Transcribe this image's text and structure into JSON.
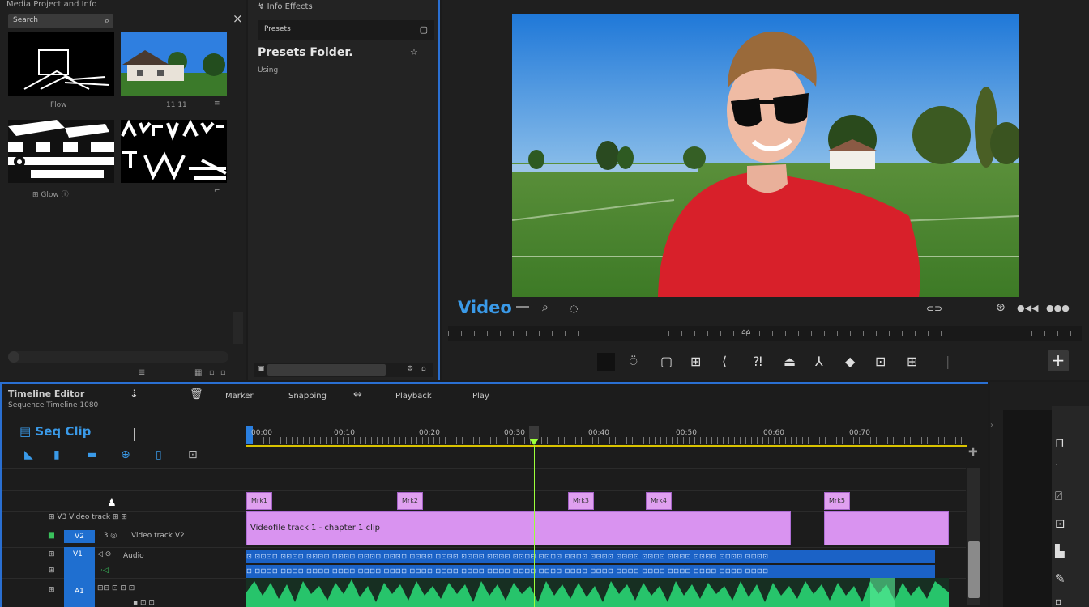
{
  "media": {
    "header": "Media Project and Info",
    "search_label": "Search",
    "items": [
      {
        "label": "Flow"
      },
      {
        "label": "11 11"
      },
      {
        "label": "Glow"
      },
      {
        "label": ""
      }
    ],
    "footer_icons": [
      "list-icon",
      "grid-icon",
      "sort-icon"
    ]
  },
  "effects": {
    "header": "Info Effects",
    "field": "Presets",
    "title": "Presets Folder.",
    "subtitle": "Using"
  },
  "viewer": {
    "title": "Video"
  },
  "timeline": {
    "title": "Timeline Editor",
    "subtitle": "Sequence Timeline 1080",
    "menu": [
      "Marker",
      "Snapping",
      "Playback",
      "Play"
    ],
    "sequence": "Seq Clip",
    "timecodes": [
      "00:00",
      "00:10",
      "00:20",
      "00:30",
      "00:40",
      "00:50",
      "00:60",
      "00:70"
    ],
    "markers": [
      "Mrk1",
      "Mrk2",
      "Mrk3",
      "Mrk4",
      "Mrk5"
    ],
    "video_clip": "Videofile track 1 - chapter 1 clip",
    "tracks": [
      {
        "name": "V3 Video track",
        "target": "V3"
      },
      {
        "name": "V2",
        "status": "Video track V2"
      },
      {
        "name": "V1",
        "status": "Audio"
      },
      {
        "name": "A1"
      }
    ]
  },
  "colors": {
    "accent": "#2a6fd1",
    "clip_pink": "#d993f0",
    "clip_blue": "#1b62c6",
    "audio_green": "#2ee07a",
    "playhead": "#9cff3b"
  }
}
